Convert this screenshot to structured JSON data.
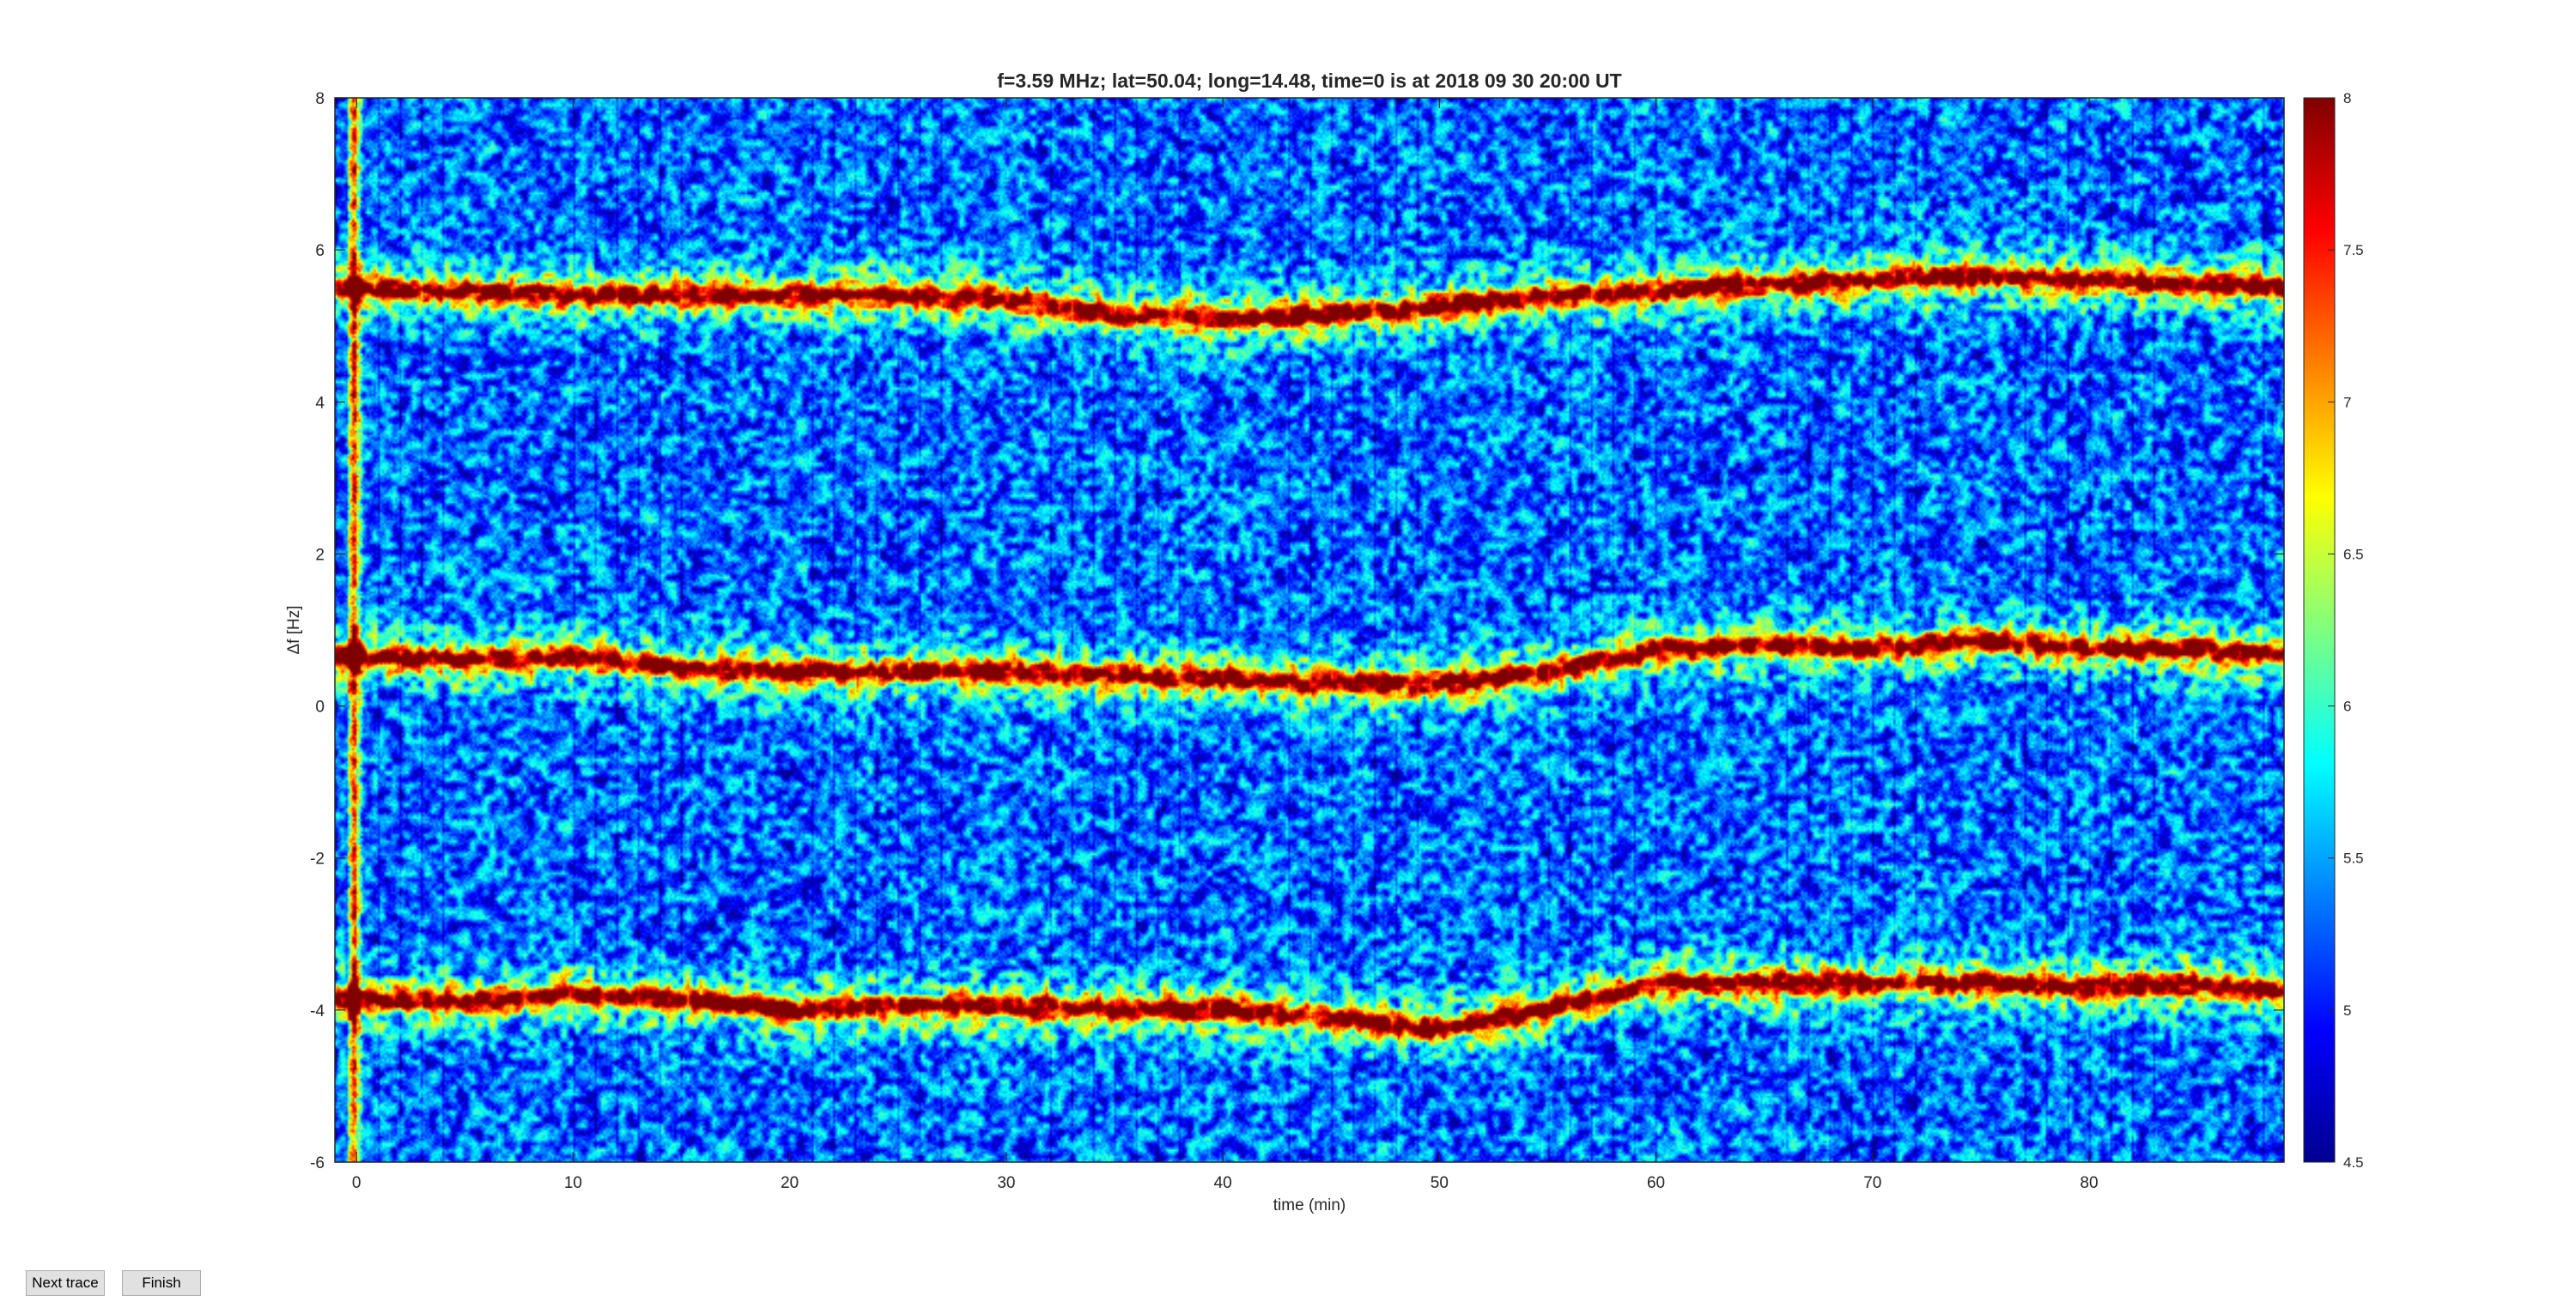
{
  "buttons": {
    "next": "Next trace",
    "finish": "Finish"
  },
  "chart_data": {
    "type": "heatmap",
    "title": "f=3.59 MHz;  lat=50.04; long=14.48, time=0 is at 2018 09 30 20:00 UT",
    "xlabel": "time (min)",
    "ylabel": "Δf [Hz]",
    "xlim": [
      -1,
      89
    ],
    "ylim": [
      -6,
      8
    ],
    "xticks": [
      0,
      10,
      20,
      30,
      40,
      50,
      60,
      70,
      80
    ],
    "yticks": [
      -6,
      -4,
      -2,
      0,
      2,
      4,
      6,
      8
    ],
    "colorbar": {
      "min": 4.5,
      "max": 8,
      "ticks": [
        4.5,
        5,
        5.5,
        6,
        6.5,
        7,
        7.5,
        8
      ],
      "colormap": "jet"
    },
    "background_level": 5.3,
    "traces": [
      {
        "time": [
          0,
          5,
          10,
          15,
          20,
          25,
          30,
          35,
          40,
          45,
          50,
          55,
          60,
          65,
          70,
          75,
          80,
          85,
          89
        ],
        "df": [
          5.5,
          5.45,
          5.4,
          5.4,
          5.4,
          5.4,
          5.35,
          5.15,
          5.1,
          5.15,
          5.25,
          5.4,
          5.45,
          5.55,
          5.6,
          5.65,
          5.6,
          5.55,
          5.5
        ]
      },
      {
        "time": [
          0,
          5,
          10,
          15,
          20,
          25,
          30,
          35,
          40,
          45,
          50,
          55,
          60,
          65,
          70,
          75,
          80,
          85,
          89
        ],
        "df": [
          0.65,
          0.6,
          0.65,
          0.5,
          0.45,
          0.45,
          0.45,
          0.4,
          0.35,
          0.3,
          0.3,
          0.45,
          0.75,
          0.8,
          0.75,
          0.85,
          0.75,
          0.75,
          0.65
        ]
      },
      {
        "time": [
          0,
          5,
          10,
          15,
          20,
          25,
          30,
          35,
          40,
          45,
          50,
          55,
          60,
          65,
          70,
          75,
          80,
          85,
          89
        ],
        "df": [
          -3.85,
          -3.9,
          -3.8,
          -3.85,
          -4.0,
          -3.95,
          -3.95,
          -4.0,
          -4.0,
          -4.1,
          -4.25,
          -4.0,
          -3.65,
          -3.65,
          -3.65,
          -3.65,
          -3.7,
          -3.65,
          -3.75
        ]
      }
    ],
    "strong_column_time": -0.1,
    "grid": false,
    "legend": "none"
  }
}
